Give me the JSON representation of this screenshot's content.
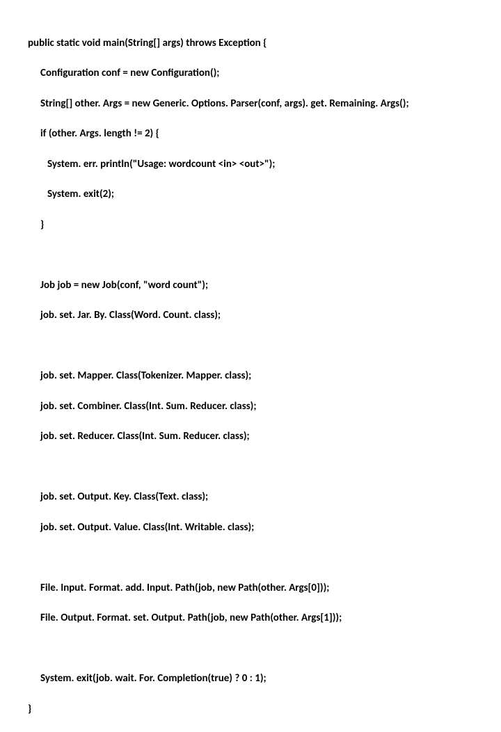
{
  "lines": {
    "l0": "public static void main(String[] args) throws Exception {",
    "l1": "Configuration conf = new Configuration();",
    "l2": "String[] other. Args = new Generic. Options. Parser(conf, args). get. Remaining. Args();",
    "l3": "if (other. Args. length != 2) {",
    "l4": "System. err. println(\"Usage: wordcount <in> <out>\");",
    "l5": "System. exit(2);",
    "l6": "}",
    "l7": "Job job = new Job(conf, \"word count\");",
    "l8": "job. set. Jar. By. Class(Word. Count. class);",
    "l9": "job. set. Mapper. Class(Tokenizer. Mapper. class);",
    "l10": "job. set. Combiner. Class(Int. Sum. Reducer. class);",
    "l11": "job. set. Reducer. Class(Int. Sum. Reducer. class);",
    "l12": "job. set. Output. Key. Class(Text. class);",
    "l13": "job. set. Output. Value. Class(Int. Writable. class);",
    "l14": "File. Input. Format. add. Input. Path(job, new Path(other. Args[0]));",
    "l15": "File. Output. Format. set. Output. Path(job, new Path(other. Args[1]));",
    "l16": "System. exit(job. wait. For. Completion(true) ? 0 : 1);",
    "l17": "}"
  }
}
